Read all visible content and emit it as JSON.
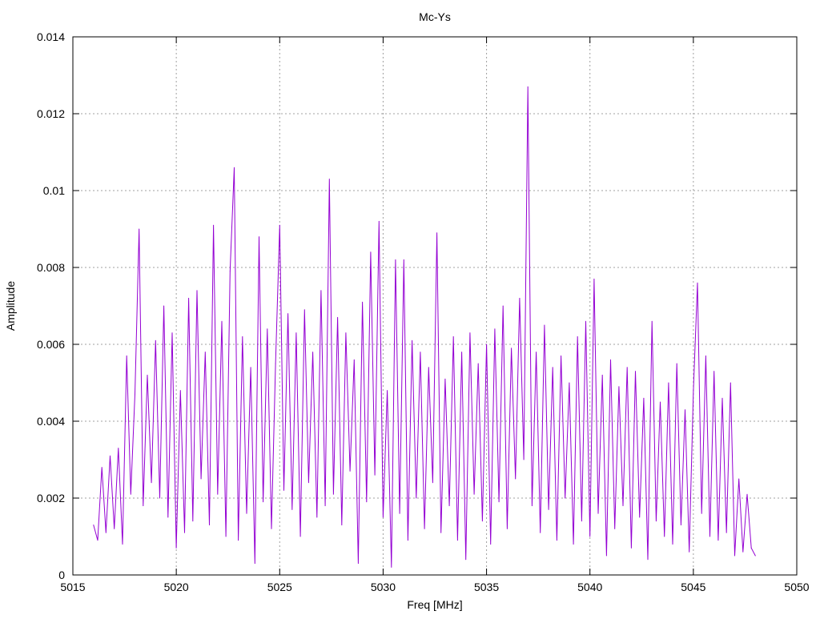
{
  "chart_data": {
    "type": "line",
    "title": "Mc-Ys",
    "xlabel": "Freq [MHz]",
    "ylabel": "Amplitude",
    "xlim": [
      5015,
      5050
    ],
    "ylim": [
      0,
      0.014
    ],
    "xticks": [
      5015,
      5020,
      5025,
      5030,
      5035,
      5040,
      5045,
      5050
    ],
    "xtick_labels": [
      "5015",
      "5020",
      "5025",
      "5030",
      "5035",
      "5040",
      "5045",
      "5050"
    ],
    "yticks": [
      0,
      0.002,
      0.004,
      0.006,
      0.008,
      0.01,
      0.012,
      0.014
    ],
    "ytick_labels": [
      "0",
      "0.002",
      "0.004",
      "0.006",
      "0.008",
      "0.01",
      "0.012",
      "0.014"
    ],
    "grid": true,
    "legend": "none",
    "series": [
      {
        "name": "Mc-Ys",
        "color": "#9400d3",
        "x_start": 5016.0,
        "x_step": 0.2,
        "values": [
          0.0013,
          0.0009,
          0.0028,
          0.0011,
          0.0031,
          0.0012,
          0.0033,
          0.0008,
          0.0057,
          0.0021,
          0.0047,
          0.009,
          0.0018,
          0.0052,
          0.0024,
          0.0061,
          0.002,
          0.007,
          0.0015,
          0.0063,
          0.0007,
          0.0048,
          0.0011,
          0.0072,
          0.0014,
          0.0074,
          0.0025,
          0.0058,
          0.0013,
          0.0091,
          0.0021,
          0.0066,
          0.001,
          0.0079,
          0.0106,
          0.0009,
          0.0062,
          0.0016,
          0.0054,
          0.0003,
          0.0088,
          0.0019,
          0.0064,
          0.0012,
          0.0055,
          0.0091,
          0.0022,
          0.0068,
          0.0017,
          0.0063,
          0.001,
          0.0069,
          0.0024,
          0.0058,
          0.0015,
          0.0074,
          0.0018,
          0.0103,
          0.0021,
          0.0067,
          0.0013,
          0.0063,
          0.0027,
          0.0056,
          0.0003,
          0.0071,
          0.0019,
          0.0084,
          0.0026,
          0.0092,
          0.0015,
          0.0048,
          0.0002,
          0.0082,
          0.0016,
          0.0082,
          0.0009,
          0.0061,
          0.002,
          0.0058,
          0.0012,
          0.0054,
          0.0024,
          0.0089,
          0.0011,
          0.0051,
          0.0018,
          0.0062,
          0.0009,
          0.0058,
          0.0004,
          0.0063,
          0.0021,
          0.0055,
          0.0014,
          0.006,
          0.0008,
          0.0064,
          0.0019,
          0.007,
          0.0012,
          0.0059,
          0.0025,
          0.0072,
          0.003,
          0.0127,
          0.0018,
          0.0058,
          0.0011,
          0.0065,
          0.0017,
          0.0054,
          0.0009,
          0.0057,
          0.002,
          0.005,
          0.0008,
          0.0062,
          0.0014,
          0.0066,
          0.001,
          0.0077,
          0.0016,
          0.0052,
          0.0005,
          0.0056,
          0.0012,
          0.0049,
          0.0018,
          0.0054,
          0.0007,
          0.0053,
          0.0015,
          0.0046,
          0.0004,
          0.0066,
          0.0014,
          0.0045,
          0.001,
          0.005,
          0.0008,
          0.0055,
          0.0013,
          0.0043,
          0.0006,
          0.0048,
          0.0076,
          0.0016,
          0.0057,
          0.001,
          0.0053,
          0.0009,
          0.0046,
          0.0011,
          0.005,
          0.0005,
          0.0025,
          0.0006,
          0.0021,
          0.0007,
          0.0005
        ]
      }
    ]
  }
}
